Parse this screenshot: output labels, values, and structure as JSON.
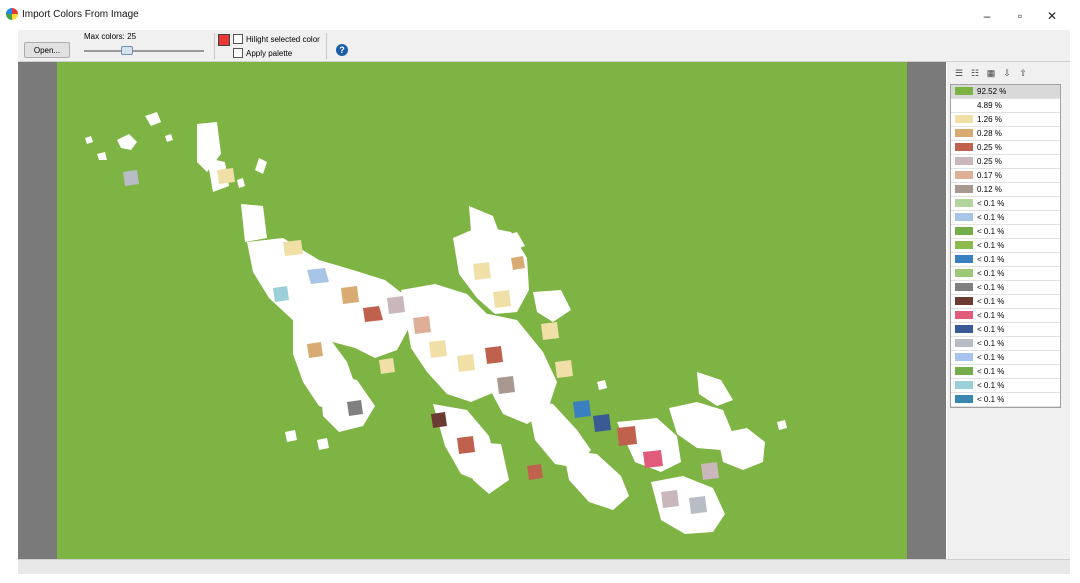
{
  "window": {
    "title": "Import Colors From Image",
    "controls": {
      "minimize": "–",
      "restore": "▫",
      "close": "✕"
    }
  },
  "toolbar": {
    "open_label": "Open...",
    "max_colors_label": "Max colors: 25",
    "max_colors_value": 25,
    "hilight_label": "Hilight selected color",
    "hilight_checked": false,
    "apply_palette_label": "Apply palette",
    "apply_palette_checked": false,
    "help_glyph": "?"
  },
  "map": {
    "background": "#7db443"
  },
  "panel": {
    "tools": [
      {
        "icon": "sort-list-icon",
        "glyph": "☰"
      },
      {
        "icon": "sort-by-hue-icon",
        "glyph": "☷"
      },
      {
        "icon": "color-grid-icon",
        "glyph": "▦"
      },
      {
        "icon": "export-palette-icon",
        "glyph": "⇩"
      },
      {
        "icon": "import-palette-icon",
        "glyph": "⇧"
      }
    ],
    "colors": [
      {
        "pct": "92.52 %",
        "color": "#7db443",
        "selected": true
      },
      {
        "pct": "4.89 %",
        "color": "#ffffff",
        "selected": false
      },
      {
        "pct": "1.26 %",
        "color": "#f1dfa8",
        "selected": false
      },
      {
        "pct": "0.28 %",
        "color": "#d8ab72",
        "selected": false
      },
      {
        "pct": "0.25 %",
        "color": "#c0614d",
        "selected": false
      },
      {
        "pct": "0.25 %",
        "color": "#c9b7bb",
        "selected": false
      },
      {
        "pct": "0.17 %",
        "color": "#dfae96",
        "selected": false
      },
      {
        "pct": "0.12 %",
        "color": "#a89890",
        "selected": false
      },
      {
        "pct": "< 0.1 %",
        "color": "#b3d49c",
        "selected": false
      },
      {
        "pct": "< 0.1 %",
        "color": "#a8c4e6",
        "selected": false
      },
      {
        "pct": "< 0.1 %",
        "color": "#74ad4a",
        "selected": false
      },
      {
        "pct": "< 0.1 %",
        "color": "#8ebc4c",
        "selected": false
      },
      {
        "pct": "< 0.1 %",
        "color": "#3a80c0",
        "selected": false
      },
      {
        "pct": "< 0.1 %",
        "color": "#9cc878",
        "selected": false
      },
      {
        "pct": "< 0.1 %",
        "color": "#808080",
        "selected": false
      },
      {
        "pct": "< 0.1 %",
        "color": "#6b3a33",
        "selected": false
      },
      {
        "pct": "< 0.1 %",
        "color": "#e05c7a",
        "selected": false
      },
      {
        "pct": "< 0.1 %",
        "color": "#3a5a96",
        "selected": false
      },
      {
        "pct": "< 0.1 %",
        "color": "#b8bcc4",
        "selected": false
      },
      {
        "pct": "< 0.1 %",
        "color": "#a8c4ee",
        "selected": false
      },
      {
        "pct": "< 0.1 %",
        "color": "#74ad4a",
        "selected": false
      },
      {
        "pct": "< 0.1 %",
        "color": "#9cd0d8",
        "selected": false
      },
      {
        "pct": "< 0.1 %",
        "color": "#3a88b0",
        "selected": false
      }
    ]
  }
}
